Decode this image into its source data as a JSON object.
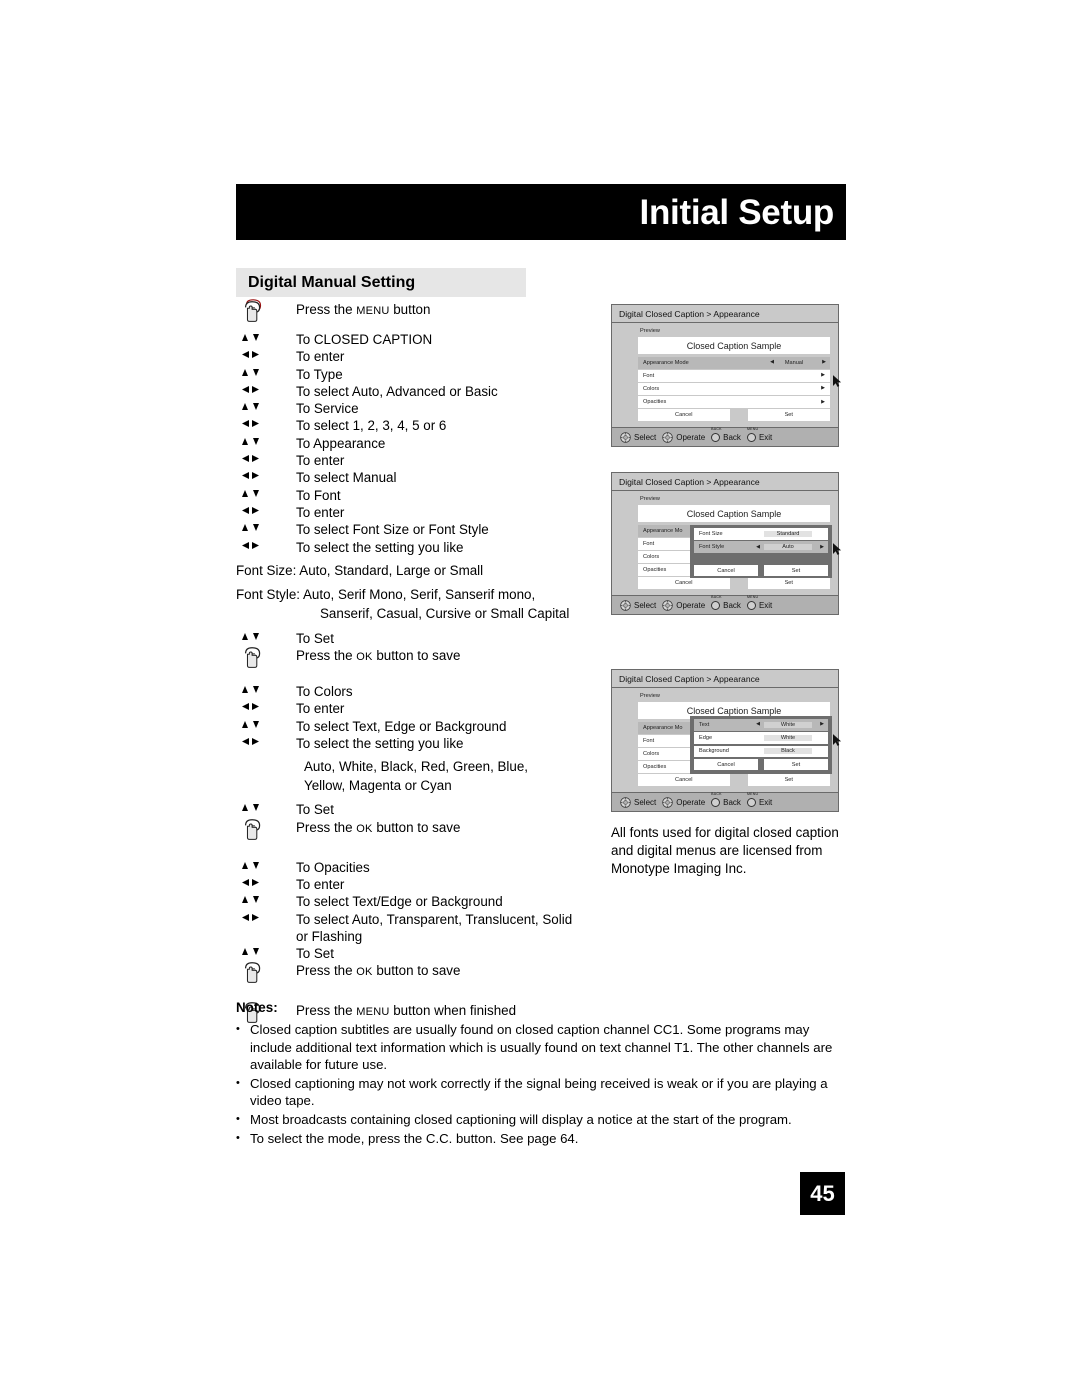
{
  "header": {
    "title": "Initial Setup"
  },
  "section": {
    "title": "Digital Manual Setting"
  },
  "steps": [
    {
      "icon": "hand-press-button-icon",
      "text": "Press the ",
      "sc": "MENU",
      "tail": " button"
    },
    {
      "icon": "up-down-arrows-icon",
      "text": "To CLOSED CAPTION"
    },
    {
      "icon": "left-right-arrows-icon",
      "text": "To enter"
    },
    {
      "icon": "up-down-arrows-icon",
      "text": "To Type"
    },
    {
      "icon": "left-right-arrows-icon",
      "text": "To select Auto, Advanced or Basic"
    },
    {
      "icon": "up-down-arrows-icon",
      "text": "To Service"
    },
    {
      "icon": "left-right-arrows-icon",
      "text": "To select 1, 2, 3, 4, 5 or 6"
    },
    {
      "icon": "up-down-arrows-icon",
      "text": "To Appearance"
    },
    {
      "icon": "left-right-arrows-icon",
      "text": "To enter"
    },
    {
      "icon": "left-right-arrows-icon",
      "text": "To select Manual"
    },
    {
      "icon": "up-down-arrows-icon",
      "text": "To Font"
    },
    {
      "icon": "left-right-arrows-icon",
      "text": "To enter"
    },
    {
      "icon": "up-down-arrows-icon",
      "text": "To select Font Size or Font Style"
    },
    {
      "icon": "left-right-arrows-icon",
      "text": "To select the setting you like"
    }
  ],
  "font_lines": {
    "size": "Font Size: Auto, Standard, Large or Small",
    "style_1": "Font Style: Auto, Serif Mono, Serif, Sanserif mono,",
    "style_2": "Sanserif, Casual, Cursive or Small Capital"
  },
  "steps_set_font": [
    {
      "icon": "up-down-arrows-icon",
      "text": "To Set"
    },
    {
      "icon": "hand-press-button-icon",
      "text": "Press the ",
      "sc": "OK",
      "tail": " button to save"
    }
  ],
  "steps_colors": [
    {
      "icon": "up-down-arrows-icon",
      "text": "To Colors"
    },
    {
      "icon": "left-right-arrows-icon",
      "text": "To enter"
    },
    {
      "icon": "up-down-arrows-icon",
      "text": "To select Text, Edge or Background"
    },
    {
      "icon": "left-right-arrows-icon",
      "text": "To select the setting you like"
    }
  ],
  "color_lines": {
    "line_1": "Auto, White, Black, Red, Green, Blue,",
    "line_2": "Yellow, Magenta or Cyan"
  },
  "steps_set_colors": [
    {
      "icon": "up-down-arrows-icon",
      "text": "To Set"
    },
    {
      "icon": "hand-press-button-icon",
      "text": "Press the ",
      "sc": "OK",
      "tail": " button to save"
    }
  ],
  "steps_opacities": [
    {
      "icon": "up-down-arrows-icon",
      "text": "To Opacities"
    },
    {
      "icon": "left-right-arrows-icon",
      "text": "To enter"
    },
    {
      "icon": "up-down-arrows-icon",
      "text": "To select Text/Edge or Background"
    },
    {
      "icon": "left-right-arrows-icon",
      "text": "To select Auto, Transparent, Translucent, Solid"
    }
  ],
  "opacity_cont": "or Flashing",
  "steps_final": [
    {
      "icon": "up-down-arrows-icon",
      "text": "To Set"
    },
    {
      "icon": "hand-press-button-icon",
      "text": "Press the ",
      "sc": "OK",
      "tail": " button to save"
    },
    {
      "icon": "hand-press-button-icon",
      "text": "Press the ",
      "sc": "MENU",
      "tail": " button when finished"
    }
  ],
  "osd_common": {
    "title": "Digital Closed Caption  >  Appearance",
    "preview_label": "Preview",
    "sample_text": "Closed Caption Sample",
    "cancel": "Cancel",
    "set": "Set",
    "footer": {
      "select": "Select",
      "operate": "Operate",
      "back_sup": "BACK",
      "back": "Back",
      "exit_sup": "MENU",
      "exit": "Exit"
    }
  },
  "osd1": {
    "rows": [
      {
        "label": "Appearance Mode",
        "value": "Manual",
        "selected": true,
        "arrows": true
      },
      {
        "label": "Font",
        "value": "",
        "selected": false,
        "arrows": false
      },
      {
        "label": "Colors",
        "value": "",
        "selected": false,
        "arrows": false
      },
      {
        "label": "Opacities",
        "value": "",
        "selected": false,
        "arrows": false
      }
    ]
  },
  "osd2": {
    "rows": [
      {
        "label": "Appearance Mo",
        "value": "",
        "selected": true,
        "arrows": false
      },
      {
        "label": "Font",
        "value": "",
        "selected": false,
        "arrows": false
      },
      {
        "label": "Colors",
        "value": "",
        "selected": false,
        "arrows": false
      },
      {
        "label": "Opacities",
        "value": "",
        "selected": false,
        "arrows": false
      }
    ],
    "submenu": [
      {
        "label": "Font Size",
        "value": "Standard",
        "selected": false,
        "arrows": false
      },
      {
        "label": "Font Style",
        "value": "Auto",
        "selected": true,
        "arrows": true
      }
    ]
  },
  "osd3": {
    "rows": [
      {
        "label": "Appearance Mo",
        "value": "",
        "selected": true,
        "arrows": false
      },
      {
        "label": "Font",
        "value": "",
        "selected": false,
        "arrows": false
      },
      {
        "label": "Colors",
        "value": "",
        "selected": false,
        "arrows": false
      },
      {
        "label": "Opacities",
        "value": "",
        "selected": false,
        "arrows": false
      }
    ],
    "submenu": [
      {
        "label": "Text",
        "value": "White",
        "selected": true,
        "arrows": true
      },
      {
        "label": "Edge",
        "value": "White",
        "selected": false,
        "arrows": false
      },
      {
        "label": "Background",
        "value": "Black",
        "selected": false,
        "arrows": false
      }
    ]
  },
  "side_note": "All fonts used for digital closed caption and digital menus are licensed from Monotype Imaging Inc.",
  "notes": {
    "title": "Notes:",
    "items": [
      "Closed caption subtitles are usually found on closed caption channel CC1. Some programs may include additional text information which is usually found on text channel T1. The other channels are available for future use.",
      "Closed captioning may not work correctly if the signal being received is weak or if you are playing a video tape.",
      "Most broadcasts containing closed captioning will display a notice at the start of the program.",
      "To select the mode, press the C.C. button. See page 64."
    ]
  },
  "page_number": "45"
}
